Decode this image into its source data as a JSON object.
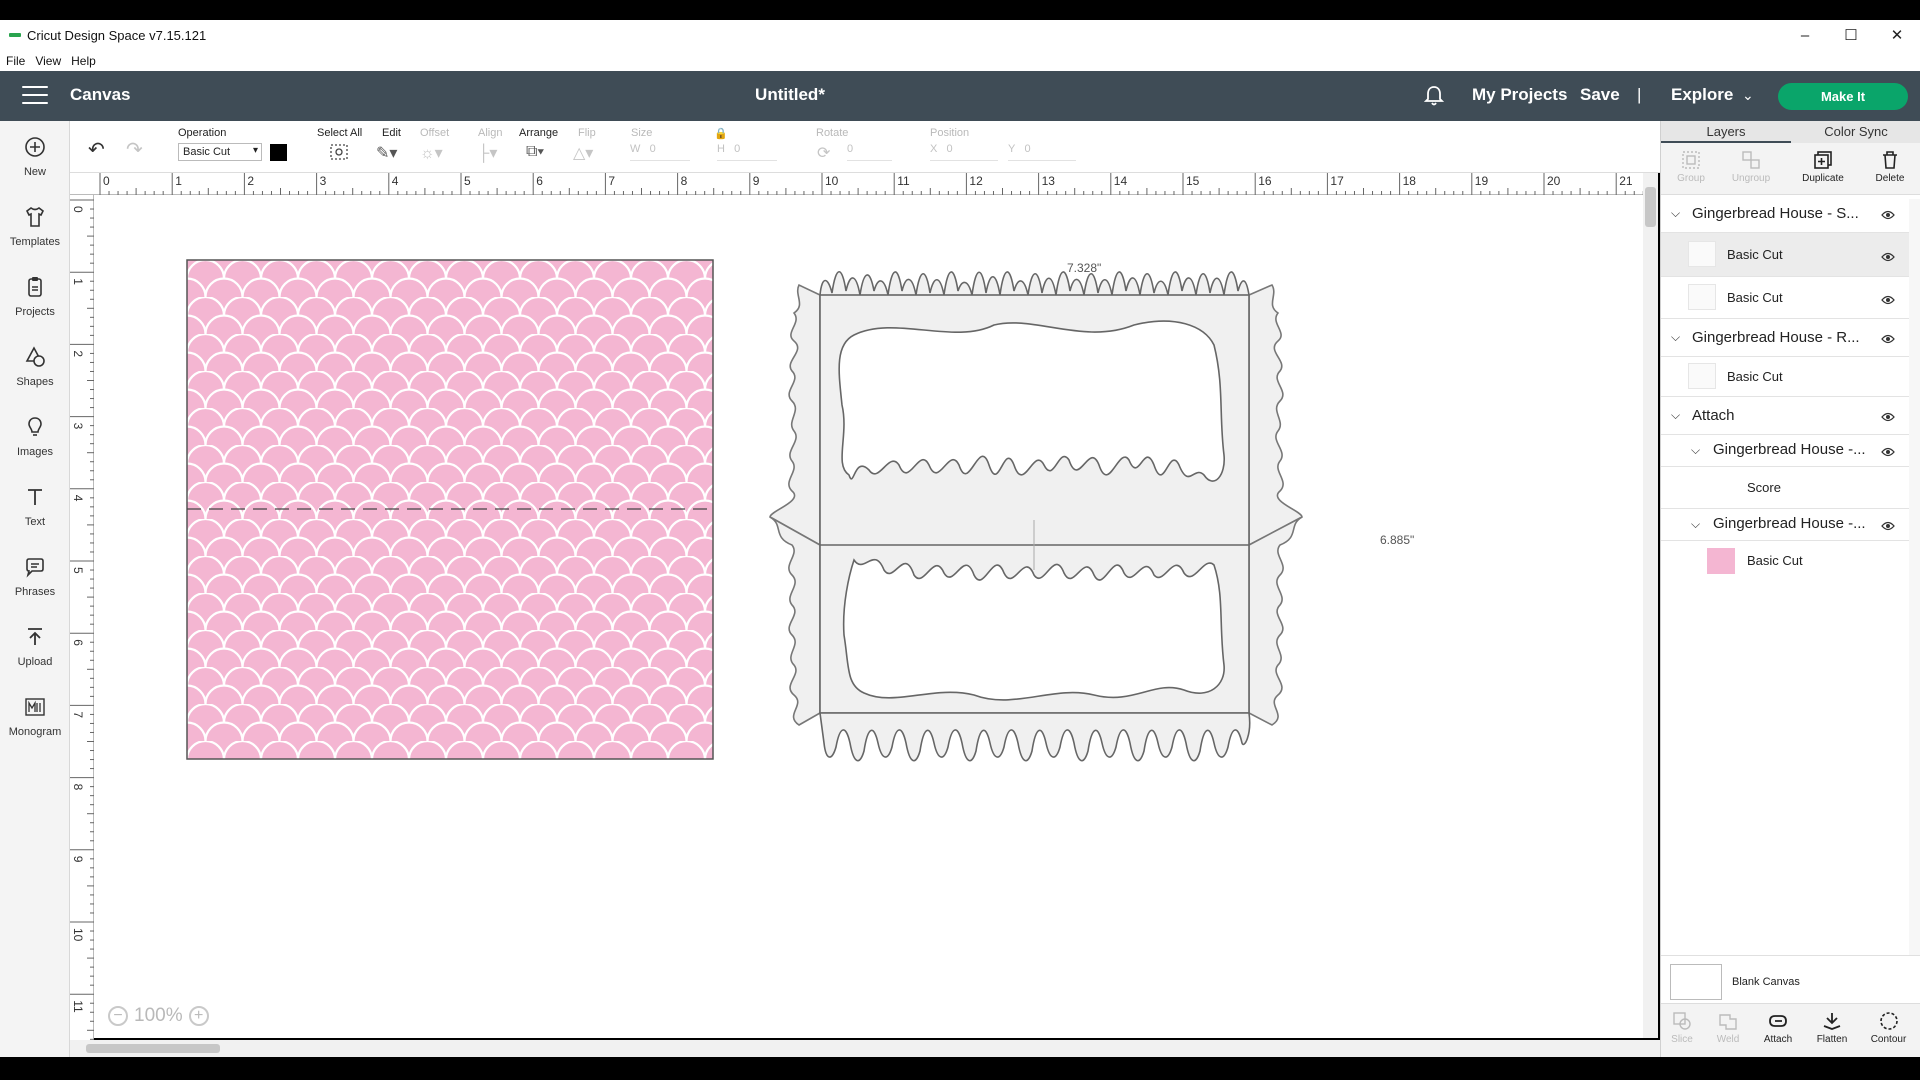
{
  "window": {
    "title": "Cricut Design Space  v7.15.121"
  },
  "menu": [
    "File",
    "View",
    "Help"
  ],
  "header": {
    "section": "Canvas",
    "doc_title": "Untitled*",
    "my_projects": "My Projects",
    "save": "Save",
    "separator": "|",
    "explore": "Explore",
    "make_it": "Make It"
  },
  "sidebar": {
    "items": [
      {
        "label": "New",
        "icon": "plus-circle-icon"
      },
      {
        "label": "Templates",
        "icon": "shirt-icon"
      },
      {
        "label": "Projects",
        "icon": "clipboard-icon"
      },
      {
        "label": "Shapes",
        "icon": "shapes-icon"
      },
      {
        "label": "Images",
        "icon": "bulb-icon"
      },
      {
        "label": "Text",
        "icon": "text-icon"
      },
      {
        "label": "Phrases",
        "icon": "speech-bubble-icon"
      },
      {
        "label": "Upload",
        "icon": "upload-icon"
      },
      {
        "label": "Monogram",
        "icon": "monogram-icon"
      }
    ]
  },
  "toolbar": {
    "operation_label": "Operation",
    "operation_value": "Basic Cut",
    "operation_color": "#000000",
    "select_all": "Select All",
    "edit": "Edit",
    "offset": "Offset",
    "align": "Align",
    "arrange": "Arrange",
    "flip": "Flip",
    "size": "Size",
    "w": "W",
    "h": "H",
    "size_w": "0",
    "size_h": "0",
    "rotate": "Rotate",
    "rotate_value": "0",
    "position": "Position",
    "x": "X",
    "y": "Y",
    "pos_x": "0",
    "pos_y": "0"
  },
  "ruler": {
    "h_ticks": [
      "0",
      "1",
      "2",
      "3",
      "4",
      "5",
      "6",
      "7",
      "8",
      "9",
      "10",
      "11",
      "12",
      "13",
      "14",
      "15",
      "16",
      "17",
      "18",
      "19",
      "20",
      "21"
    ],
    "v_ticks": [
      "0",
      "1",
      "2",
      "3",
      "4",
      "5",
      "6",
      "7",
      "8",
      "9",
      "10",
      "11"
    ]
  },
  "canvas": {
    "width_dim": "7.328\"",
    "height_dim": "6.885\"",
    "pattern_color": "#f4b6d2",
    "zoom": "100%"
  },
  "panel": {
    "tabs": [
      "Layers",
      "Color Sync"
    ],
    "actions": [
      {
        "label": "Group",
        "enabled": false
      },
      {
        "label": "Ungroup",
        "enabled": false
      },
      {
        "label": "Duplicate",
        "enabled": true
      },
      {
        "label": "Delete",
        "enabled": true
      }
    ],
    "layers": [
      {
        "type": "group",
        "name": "Gingerbread House - S..."
      },
      {
        "type": "item",
        "name": "Basic Cut",
        "selected": true
      },
      {
        "type": "item",
        "name": "Basic Cut"
      },
      {
        "type": "group",
        "name": "Gingerbread House - R..."
      },
      {
        "type": "item",
        "name": "Basic Cut"
      },
      {
        "type": "group",
        "name": "Attach"
      },
      {
        "type": "subgroup",
        "name": "Gingerbread House -..."
      },
      {
        "type": "item",
        "name": "Score"
      },
      {
        "type": "subgroup",
        "name": "Gingerbread House -..."
      },
      {
        "type": "item",
        "name": "Basic Cut",
        "swatch": "#f4b6d2"
      }
    ],
    "blank_canvas": "Blank Canvas",
    "bottom_actions": [
      {
        "label": "Slice",
        "enabled": false
      },
      {
        "label": "Weld",
        "enabled": false
      },
      {
        "label": "Attach",
        "enabled": true
      },
      {
        "label": "Flatten",
        "enabled": true
      },
      {
        "label": "Contour",
        "enabled": true
      }
    ]
  }
}
